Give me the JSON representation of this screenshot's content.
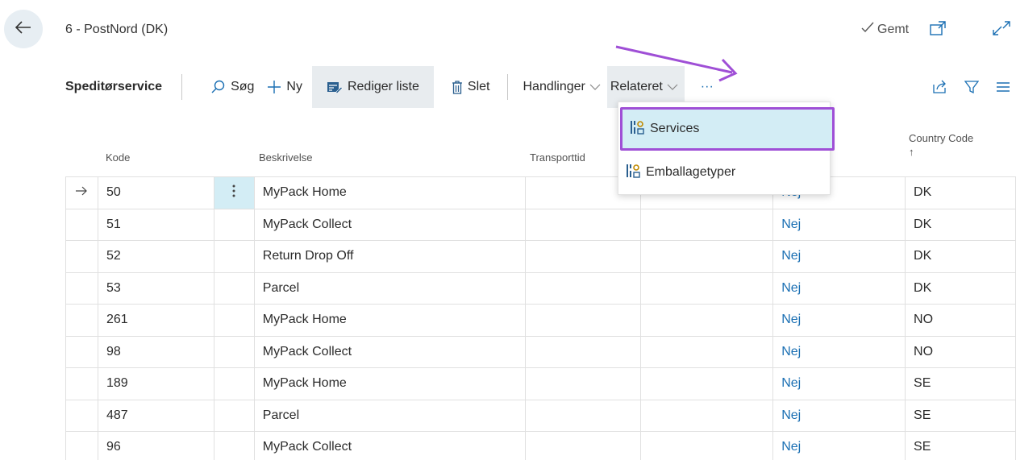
{
  "header": {
    "title": "6 - PostNord (DK)",
    "saved_label": "Gemt"
  },
  "toolbar": {
    "title": "Speditørservice",
    "search": "Søg",
    "new": "Ny",
    "edit_list": "Rediger liste",
    "delete": "Slet",
    "actions": "Handlinger",
    "related": "Relateret",
    "more": "···"
  },
  "dropdown": {
    "items": [
      {
        "label": "Services",
        "icon": "services-icon"
      },
      {
        "label": "Emballagetyper",
        "icon": "services-icon"
      }
    ]
  },
  "columns": {
    "code": "Kode",
    "description": "Beskrivelse",
    "transit": "Transporttid",
    "country_line1": "Country Code",
    "country_line2": "↑"
  },
  "rows": [
    {
      "code": "50",
      "desc": "MyPack Home",
      "flag": "Nej",
      "country": "DK"
    },
    {
      "code": "51",
      "desc": "MyPack Collect",
      "flag": "Nej",
      "country": "DK"
    },
    {
      "code": "52",
      "desc": "Return Drop Off",
      "flag": "Nej",
      "country": "DK"
    },
    {
      "code": "53",
      "desc": "Parcel",
      "flag": "Nej",
      "country": "DK"
    },
    {
      "code": "261",
      "desc": "MyPack Home",
      "flag": "Nej",
      "country": "NO"
    },
    {
      "code": "98",
      "desc": "MyPack Collect",
      "flag": "Nej",
      "country": "NO"
    },
    {
      "code": "189",
      "desc": "MyPack Home",
      "flag": "Nej",
      "country": "SE"
    },
    {
      "code": "487",
      "desc": "Parcel",
      "flag": "Nej",
      "country": "SE"
    },
    {
      "code": "96",
      "desc": "MyPack Collect",
      "flag": "Nej",
      "country": "SE"
    }
  ],
  "colors": {
    "accent_purple": "#9f4fd6",
    "selection": "#d3edf5",
    "link_blue": "#1a6fb3"
  }
}
